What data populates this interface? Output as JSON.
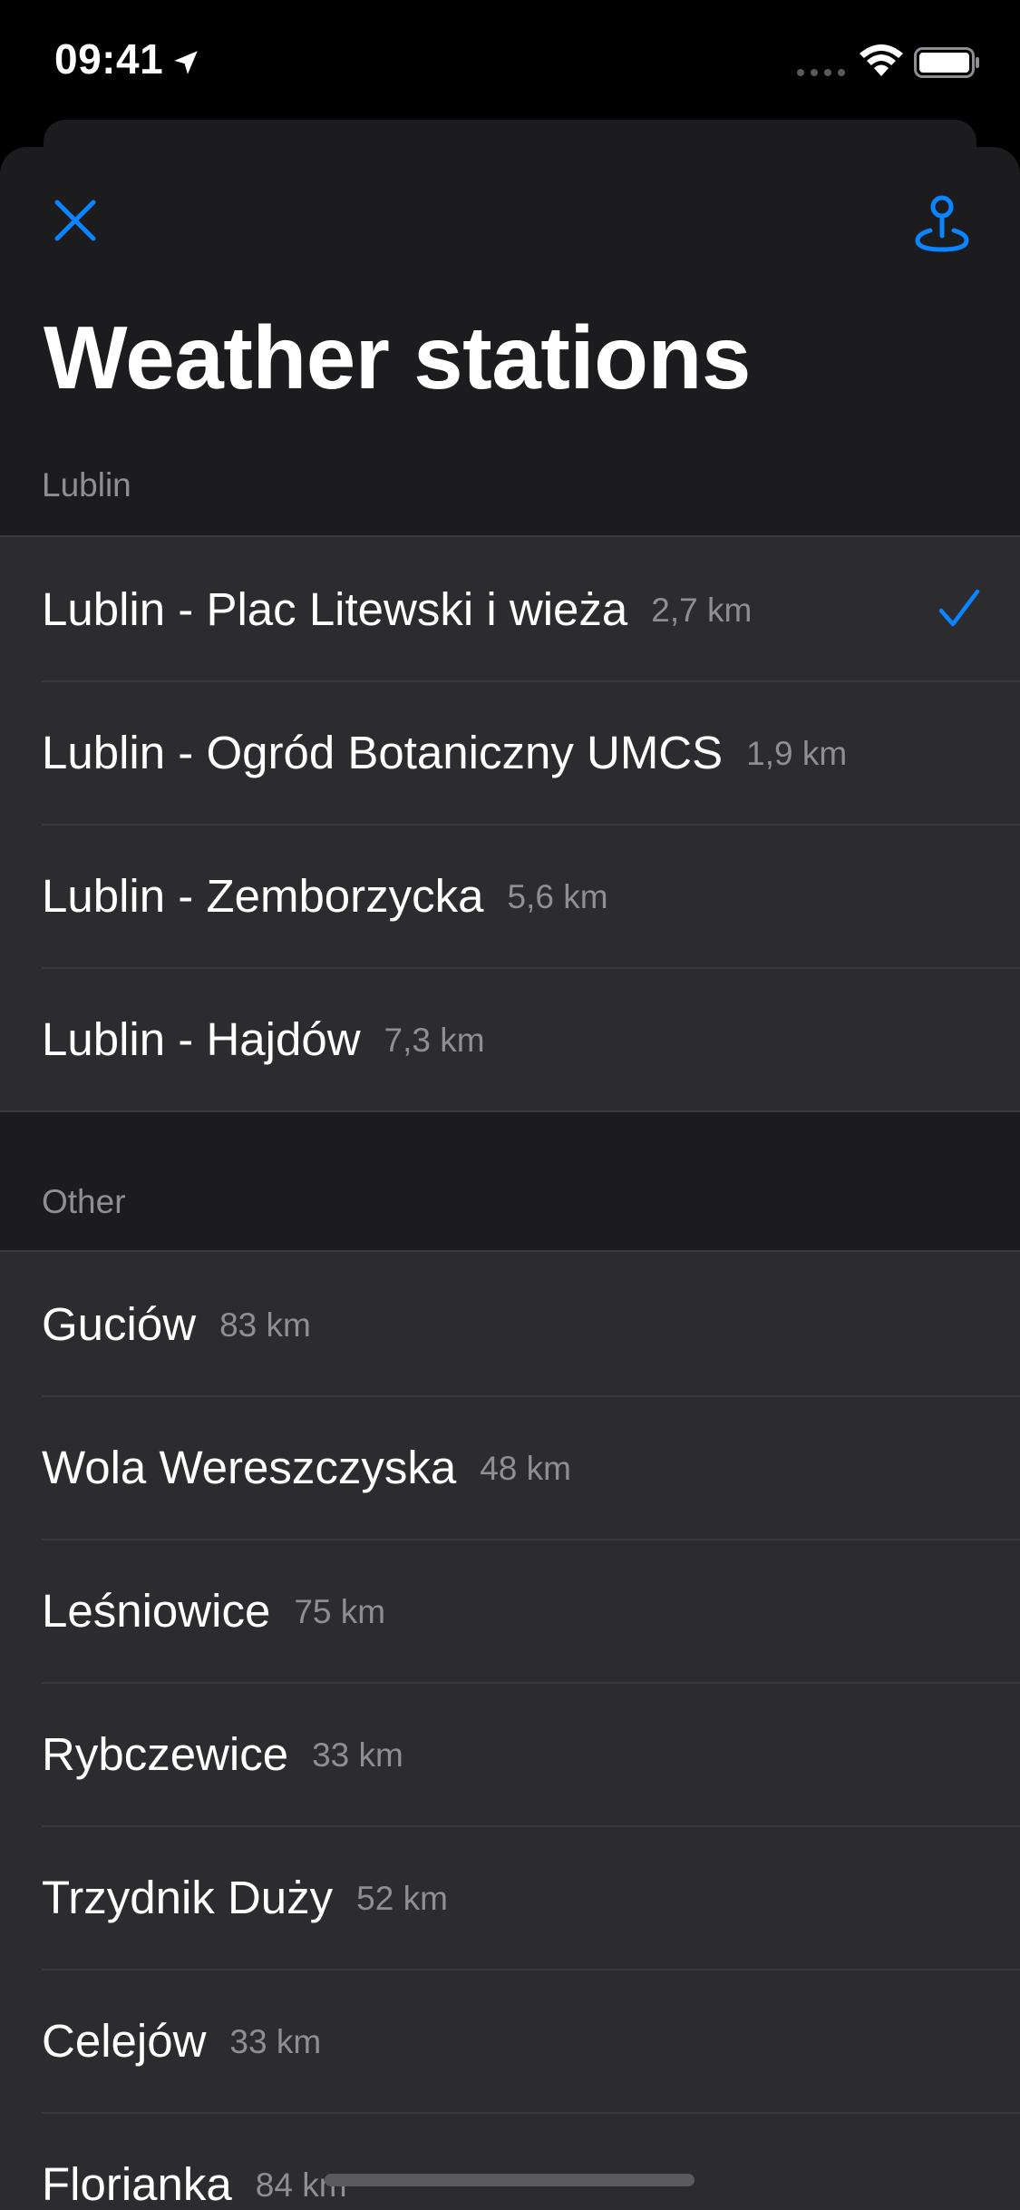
{
  "status_bar": {
    "time": "09:41",
    "icons": [
      "location-arrow-icon",
      "cellular-signal-icon",
      "wifi-icon",
      "battery-icon"
    ]
  },
  "header": {
    "title": "Weather stations",
    "close_icon": "close-icon",
    "pin_icon": "location-pin-icon"
  },
  "colors": {
    "accent": "#0a84ff",
    "background": "#1c1c1e",
    "cell": "#2c2c2e",
    "secondary_text": "#8e8e93"
  },
  "sections": [
    {
      "header": "Lublin",
      "items": [
        {
          "name": "Lublin - Plac Litewski i wieża",
          "distance": "2,7 km",
          "selected": true
        },
        {
          "name": "Lublin - Ogród Botaniczny UMCS",
          "distance": "1,9 km",
          "selected": false
        },
        {
          "name": "Lublin - Zemborzycka",
          "distance": "5,6 km",
          "selected": false
        },
        {
          "name": "Lublin - Hajdów",
          "distance": "7,3 km",
          "selected": false
        }
      ]
    },
    {
      "header": "Other",
      "items": [
        {
          "name": "Guciów",
          "distance": "83 km",
          "selected": false
        },
        {
          "name": "Wola Wereszczyska",
          "distance": "48 km",
          "selected": false
        },
        {
          "name": "Leśniowice",
          "distance": "75 km",
          "selected": false
        },
        {
          "name": "Rybczewice",
          "distance": "33 km",
          "selected": false
        },
        {
          "name": "Trzydnik Duży",
          "distance": "52 km",
          "selected": false
        },
        {
          "name": "Celejów",
          "distance": "33 km",
          "selected": false
        },
        {
          "name": "Florianka",
          "distance": "84 km",
          "selected": false
        }
      ]
    }
  ]
}
